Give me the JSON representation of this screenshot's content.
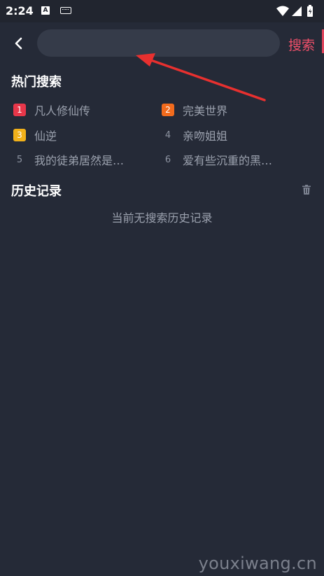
{
  "status_bar": {
    "time": "2:24",
    "notification_letter": "A"
  },
  "header": {
    "search_placeholder": "",
    "search_value": "",
    "search_button_label": "搜索"
  },
  "hot_search": {
    "title": "热门搜索",
    "items": [
      {
        "rank": "1",
        "label": "凡人修仙传",
        "badge_color": "#e8374a"
      },
      {
        "rank": "2",
        "label": "完美世界",
        "badge_color": "#f26b1d"
      },
      {
        "rank": "3",
        "label": "仙逆",
        "badge_color": "#f2b11a"
      },
      {
        "rank": "4",
        "label": "亲吻姐姐",
        "badge_color": ""
      },
      {
        "rank": "5",
        "label": "我的徒弟居然是…",
        "badge_color": ""
      },
      {
        "rank": "6",
        "label": "爱有些沉重的黑…",
        "badge_color": ""
      }
    ]
  },
  "history": {
    "title": "历史记录",
    "empty_text": "当前无搜索历史记录"
  },
  "watermark": "youxiwang.cn",
  "colors": {
    "background": "#252a37",
    "accent": "#f0506a",
    "arrow": "#e8302f"
  }
}
